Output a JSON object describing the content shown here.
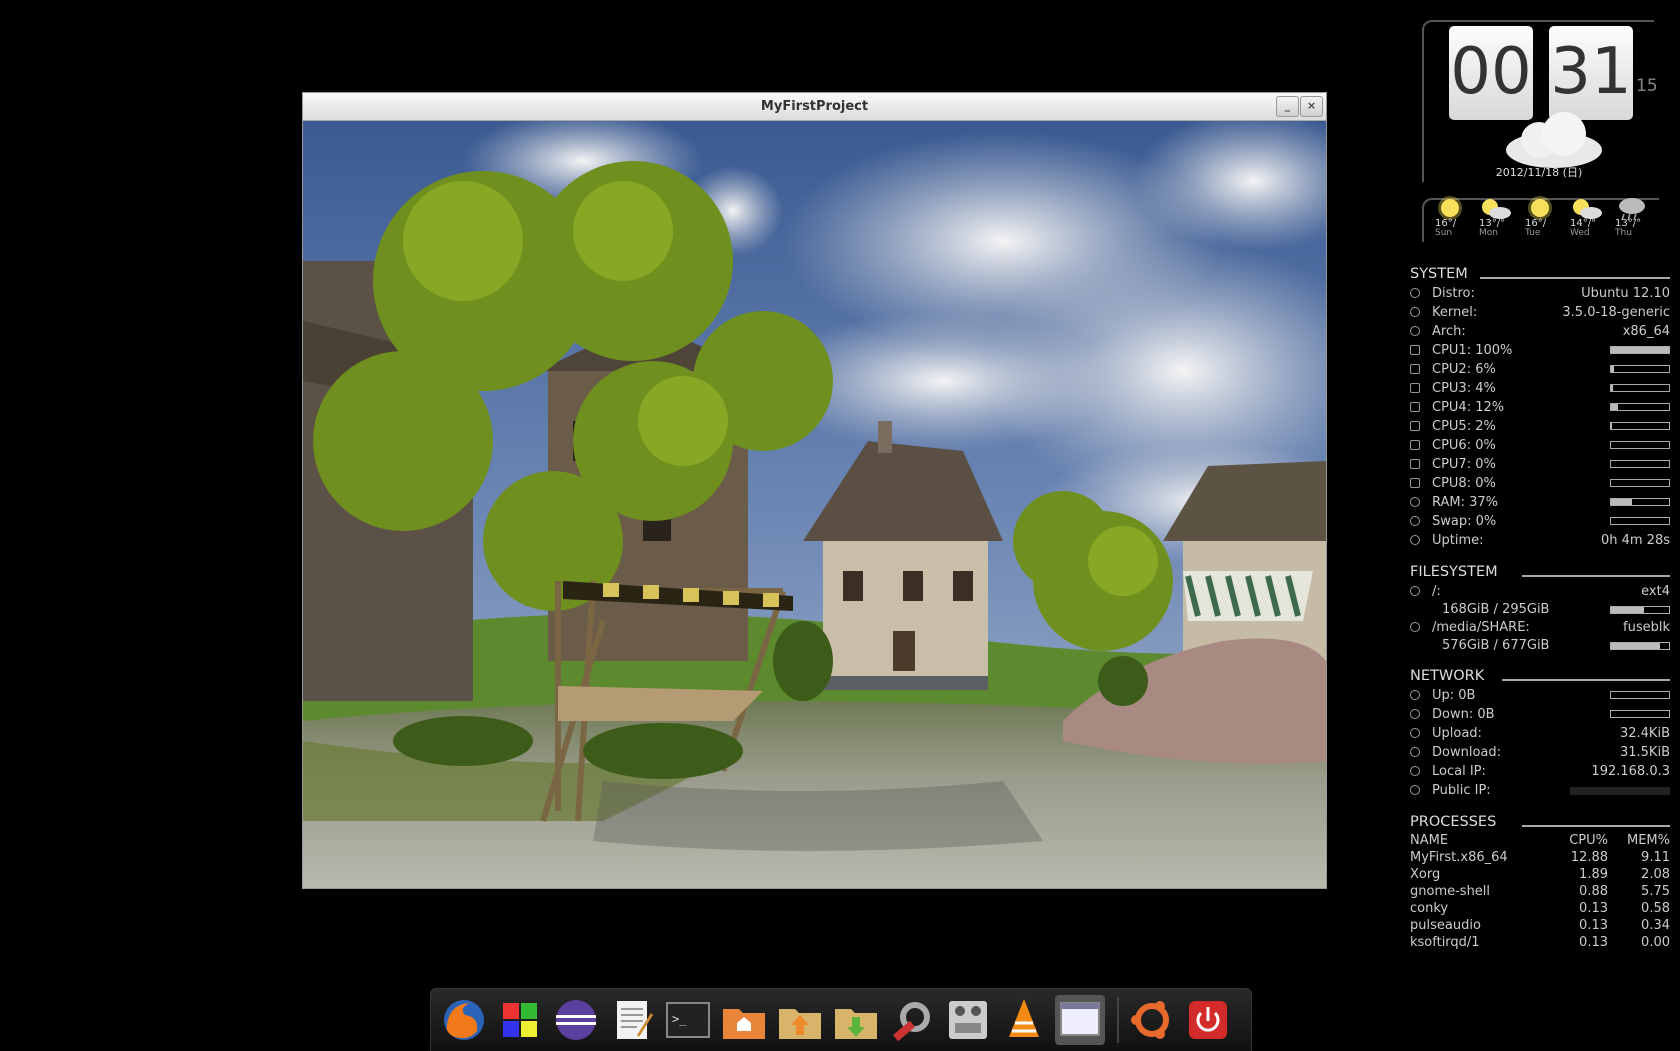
{
  "window": {
    "title": "MyFirstProject",
    "minimize_glyph": "_",
    "close_glyph": "×"
  },
  "clock": {
    "hours": "00",
    "minutes": "31",
    "seconds": "15",
    "date": "2012/11/18 (日)",
    "icon": "cloud-icon"
  },
  "forecast": [
    {
      "temp": "16°/",
      "day": "Sun",
      "icon": "sun-icon"
    },
    {
      "temp": "13°/°",
      "day": "Mon",
      "icon": "sun-cloud-icon"
    },
    {
      "temp": "16°/",
      "day": "Tue",
      "icon": "sun-icon"
    },
    {
      "temp": "14°/°",
      "day": "Wed",
      "icon": "sun-cloud-icon"
    },
    {
      "temp": "13°/°",
      "day": "Thu",
      "icon": "cloud-rain-icon"
    }
  ],
  "system": {
    "heading": "SYSTEM",
    "distro": {
      "label": "Distro:",
      "value": "Ubuntu 12.10"
    },
    "kernel": {
      "label": "Kernel:",
      "value": "3.5.0-18-generic"
    },
    "arch": {
      "label": "Arch:",
      "value": "x86_64"
    },
    "cpus": [
      {
        "label": "CPU1: 100%",
        "percent": 100
      },
      {
        "label": "CPU2: 6%",
        "percent": 6
      },
      {
        "label": "CPU3: 4%",
        "percent": 4
      },
      {
        "label": "CPU4: 12%",
        "percent": 12
      },
      {
        "label": "CPU5: 2%",
        "percent": 2
      },
      {
        "label": "CPU6: 0%",
        "percent": 0
      },
      {
        "label": "CPU7: 0%",
        "percent": 0
      },
      {
        "label": "CPU8: 0%",
        "percent": 0
      }
    ],
    "ram": {
      "label": "RAM: 37%",
      "percent": 37
    },
    "swap": {
      "label": "Swap: 0%",
      "percent": 0
    },
    "uptime": {
      "label": "Uptime:",
      "value": "0h 4m 28s"
    }
  },
  "filesystem": {
    "heading": "FILESYSTEM",
    "mounts": [
      {
        "path": "/:",
        "type": "ext4",
        "usage": "168GiB / 295GiB",
        "percent": 57
      },
      {
        "path": "/media/SHARE:",
        "type": "fuseblk",
        "usage": "576GiB / 677GiB",
        "percent": 85
      }
    ]
  },
  "network": {
    "heading": "NETWORK",
    "up": {
      "label": "Up: 0B",
      "percent": 0
    },
    "down": {
      "label": "Down: 0B",
      "percent": 0
    },
    "upload": {
      "label": "Upload:",
      "value": "32.4KiB"
    },
    "download": {
      "label": "Download:",
      "value": "31.5KiB"
    },
    "local_ip": {
      "label": "Local IP:",
      "value": "192.168.0.3"
    },
    "public_ip": {
      "label": "Public IP:",
      "value": ""
    }
  },
  "processes": {
    "heading": "PROCESSES",
    "columns": {
      "name": "NAME",
      "cpu": "CPU%",
      "mem": "MEM%"
    },
    "rows": [
      {
        "name": "MyFirst.x86_64",
        "cpu": "12.88",
        "mem": "9.11"
      },
      {
        "name": "Xorg",
        "cpu": "1.89",
        "mem": "2.08"
      },
      {
        "name": "gnome-shell",
        "cpu": "0.88",
        "mem": "5.75"
      },
      {
        "name": "conky",
        "cpu": "0.13",
        "mem": "0.58"
      },
      {
        "name": "pulseaudio",
        "cpu": "0.13",
        "mem": "0.34"
      },
      {
        "name": "ksoftirqd/1",
        "cpu": "0.13",
        "mem": "0.00"
      }
    ]
  },
  "dock": [
    "firefox-icon",
    "windows-logo-icon",
    "eclipse-icon",
    "text-editor-icon",
    "terminal-icon",
    "home-folder-icon",
    "upload-folder-icon",
    "download-folder-icon",
    "system-settings-icon",
    "mixer-icon",
    "vlc-icon",
    "window-icon",
    "ubuntu-logo-icon",
    "power-icon"
  ]
}
